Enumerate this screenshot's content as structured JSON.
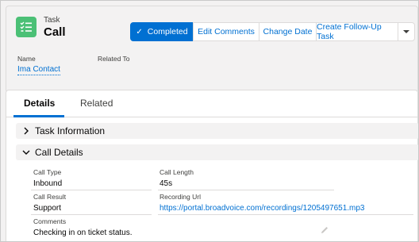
{
  "header": {
    "object_type": "Task",
    "record_title": "Call",
    "buttons": {
      "completed": "Completed",
      "edit_comments": "Edit Comments",
      "change_date": "Change Date",
      "create_follow_up": "Create Follow-Up Task"
    },
    "highlights": {
      "name_label": "Name",
      "name_value": "Ima Contact",
      "related_to_label": "Related To"
    }
  },
  "tabs": [
    {
      "label": "Details",
      "active": true
    },
    {
      "label": "Related",
      "active": false
    }
  ],
  "sections": {
    "task_information": {
      "title": "Task Information",
      "expanded": false
    },
    "call_details": {
      "title": "Call Details",
      "expanded": true,
      "fields": {
        "call_type": {
          "label": "Call Type",
          "value": "Inbound"
        },
        "call_length": {
          "label": "Call Length",
          "value": "45s"
        },
        "call_result": {
          "label": "Call Result",
          "value": "Support"
        },
        "recording_url": {
          "label": "Recording Url",
          "value": "https://portal.broadvoice.com/recordings/1205497651.mp3"
        },
        "comments": {
          "label": "Comments",
          "value": "Checking in on ticket status."
        }
      }
    }
  },
  "colors": {
    "brand": "#0070d2",
    "task_icon": "#4bc076"
  },
  "icons": [
    "task-icon",
    "check-icon",
    "chevron-down-icon",
    "chevron-right-icon",
    "pencil-icon"
  ]
}
